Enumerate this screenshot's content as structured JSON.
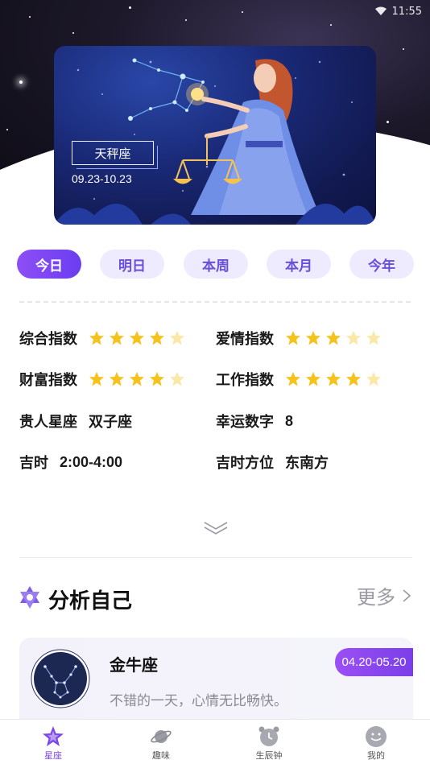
{
  "status_bar": {
    "time": "11:55"
  },
  "banner": {
    "sign_name": "天秤座",
    "date_range": "09.23-10.23"
  },
  "tabs": [
    {
      "label": "今日",
      "active": true
    },
    {
      "label": "明日",
      "active": false
    },
    {
      "label": "本周",
      "active": false
    },
    {
      "label": "本月",
      "active": false
    },
    {
      "label": "今年",
      "active": false
    }
  ],
  "fortune": {
    "overall": {
      "label": "综合指数",
      "stars": 4,
      "max": 5
    },
    "love": {
      "label": "爱情指数",
      "stars": 3,
      "max": 5
    },
    "wealth": {
      "label": "财富指数",
      "stars": 4,
      "max": 5
    },
    "work": {
      "label": "工作指数",
      "stars": 4,
      "max": 5
    },
    "noble_sign": {
      "label": "贵人星座",
      "value": "双子座"
    },
    "lucky_number": {
      "label": "幸运数字",
      "value": "8"
    },
    "lucky_time": {
      "label": "吉时",
      "value": "2:00-4:00"
    },
    "lucky_direction": {
      "label": "吉时方位",
      "value": "东南方"
    }
  },
  "section": {
    "title": "分析自己",
    "more_label": "更多"
  },
  "card": {
    "name": "金牛座",
    "description": "不错的一天，心情无比畅快。",
    "date_range": "04.20-05.20"
  },
  "nav": [
    {
      "label": "星座",
      "icon": "star-sign-icon",
      "active": true
    },
    {
      "label": "趣味",
      "icon": "planet-icon",
      "active": false
    },
    {
      "label": "生辰钟",
      "icon": "alarm-clock-icon",
      "active": false
    },
    {
      "label": "我的",
      "icon": "smiley-face-icon",
      "active": false
    }
  ],
  "colors": {
    "accent": "#7b46ec",
    "tab_inactive_bg": "#eeeaff",
    "star_filled": "#f6c21c",
    "star_empty": "#fbe8a6"
  }
}
